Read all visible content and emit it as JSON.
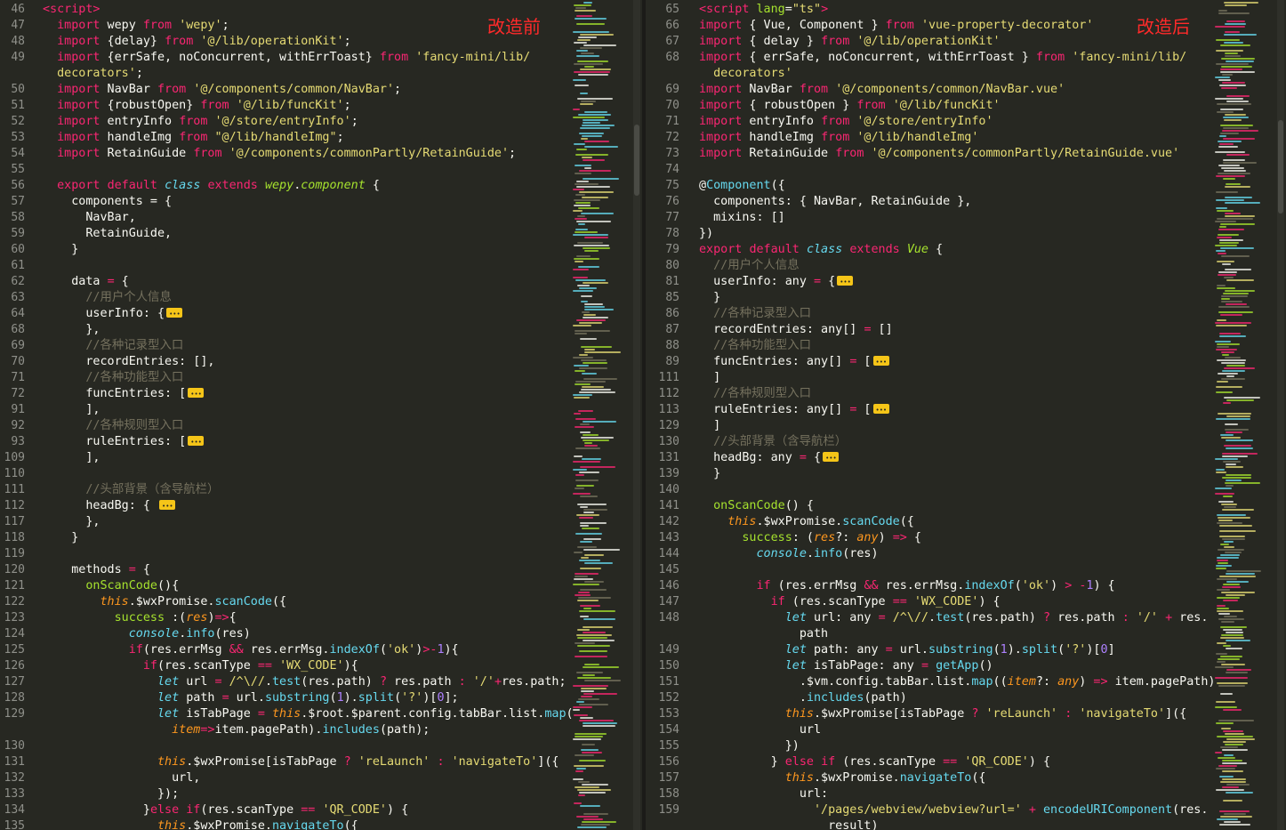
{
  "left_pane": {
    "label": "改造前",
    "lines": [
      {
        "n": "46",
        "html": "<span class='tag'>&lt;script&gt;</span>"
      },
      {
        "n": "47",
        "html": "  <span class='kw'>import</span> wepy <span class='kw'>from</span> <span class='str'>'wepy'</span>;"
      },
      {
        "n": "48",
        "html": "  <span class='kw'>import</span> {delay} <span class='kw'>from</span> <span class='str'>'@/lib/operationKit'</span>;"
      },
      {
        "n": "49",
        "html": "  <span class='kw'>import</span> {errSafe, noConcurrent, withErrToast} <span class='kw'>from</span> <span class='str'>'fancy-mini/lib/</span>"
      },
      {
        "n": "",
        "html": "  <span class='str'>decorators'</span>;"
      },
      {
        "n": "50",
        "html": "  <span class='kw'>import</span> NavBar <span class='kw'>from</span> <span class='str'>'@/components/common/NavBar'</span>;"
      },
      {
        "n": "51",
        "html": "  <span class='kw'>import</span> {robustOpen} <span class='kw'>from</span> <span class='str'>'@/lib/funcKit'</span>;"
      },
      {
        "n": "52",
        "html": "  <span class='kw'>import</span> entryInfo <span class='kw'>from</span> <span class='str'>'@/store/entryInfo'</span>;"
      },
      {
        "n": "53",
        "html": "  <span class='kw'>import</span> handleImg <span class='kw'>from</span> <span class='str'>\"@/lib/handleImg\"</span>;"
      },
      {
        "n": "54",
        "html": "  <span class='kw'>import</span> RetainGuide <span class='kw'>from</span> <span class='str'>'@/components/commonPartly/RetainGuide'</span>;"
      },
      {
        "n": "55",
        "html": ""
      },
      {
        "n": "56",
        "html": "  <span class='kw'>export</span> <span class='kw'>default</span> <span class='it'>class</span> <span class='kw'>extends</span> <span class='cls' style='font-style:italic'>wepy</span>.<span class='cls' style='font-style:italic'>component</span> {"
      },
      {
        "n": "57",
        "html": "    components = {"
      },
      {
        "n": "58",
        "html": "      NavBar,"
      },
      {
        "n": "59",
        "html": "      RetainGuide,"
      },
      {
        "n": "60",
        "html": "    }"
      },
      {
        "n": "61",
        "html": ""
      },
      {
        "n": "62",
        "html": "    data <span class='kw'>=</span> {"
      },
      {
        "n": "63",
        "html": "      <span class='cm'>//用户个人信息</span>"
      },
      {
        "n": "64",
        "html": "      userInfo: {<span class='fold'></span>"
      },
      {
        "n": "68",
        "html": "      },"
      },
      {
        "n": "69",
        "html": "      <span class='cm'>//各种记录型入口</span>"
      },
      {
        "n": "70",
        "html": "      recordEntries: [],"
      },
      {
        "n": "71",
        "html": "      <span class='cm'>//各种功能型入口</span>"
      },
      {
        "n": "72",
        "html": "      funcEntries: [<span class='fold'></span>"
      },
      {
        "n": "91",
        "html": "      ],"
      },
      {
        "n": "92",
        "html": "      <span class='cm'>//各种规则型入口</span>"
      },
      {
        "n": "93",
        "html": "      ruleEntries: [<span class='fold'></span>"
      },
      {
        "n": "109",
        "html": "      ],"
      },
      {
        "n": "110",
        "html": ""
      },
      {
        "n": "111",
        "html": "      <span class='cm'>//头部背景（含导航栏）</span>"
      },
      {
        "n": "112",
        "html": "      headBg: { <span class='fold'></span>"
      },
      {
        "n": "117",
        "html": "      },"
      },
      {
        "n": "118",
        "html": "    }"
      },
      {
        "n": "119",
        "html": ""
      },
      {
        "n": "120",
        "html": "    methods <span class='kw'>=</span> {"
      },
      {
        "n": "121",
        "html": "      <span class='cls'>onScanCode</span>(){"
      },
      {
        "n": "122",
        "html": "        <span class='this'>this</span>.$wxPromise.<span class='fn'>scanCode</span>({"
      },
      {
        "n": "123",
        "html": "          <span class='cls'>success</span> :(<span class='param'>res</span>)<span class='kw'>=&gt;</span>{"
      },
      {
        "n": "124",
        "html": "            <span class='it'>console</span>.<span class='fn'>info</span>(res)"
      },
      {
        "n": "125",
        "html": "            <span class='kw'>if</span>(res.errMsg <span class='kw'>&amp;&amp;</span> res.errMsg.<span class='fn'>indexOf</span>(<span class='str'>'ok'</span>)<span class='kw'>&gt;-</span><span class='num'>1</span>){"
      },
      {
        "n": "126",
        "html": "              <span class='kw'>if</span>(res.scanType <span class='kw'>==</span> <span class='str'>'WX_CODE'</span>){"
      },
      {
        "n": "127",
        "html": "                <span class='it'>let</span> url <span class='kw'>=</span> <span class='str'>/^\\//</span>.<span class='fn'>test</span>(res.path) <span class='kw'>?</span> res.path <span class='kw'>:</span> <span class='str'>'/'</span><span class='kw'>+</span>res.path;"
      },
      {
        "n": "128",
        "html": "                <span class='it'>let</span> path <span class='kw'>=</span> url.<span class='fn'>substring</span>(<span class='num'>1</span>).<span class='fn'>split</span>(<span class='str'>'?'</span>)[<span class='num'>0</span>];"
      },
      {
        "n": "129",
        "html": "                <span class='it'>let</span> isTabPage <span class='kw'>=</span> <span class='this'>this</span>.$root.$parent.config.tabBar.list.<span class='fn'>map</span>("
      },
      {
        "n": "",
        "html": "                  <span class='param'>item</span><span class='kw'>=&gt;</span>item.pagePath).<span class='fn'>includes</span>(path);"
      },
      {
        "n": "130",
        "html": ""
      },
      {
        "n": "131",
        "html": "                <span class='this'>this</span>.$wxPromise[isTabPage <span class='kw'>?</span> <span class='str'>'reLaunch'</span> <span class='kw'>:</span> <span class='str'>'navigateTo'</span>]({"
      },
      {
        "n": "132",
        "html": "                  url,"
      },
      {
        "n": "133",
        "html": "                });"
      },
      {
        "n": "134",
        "html": "              }<span class='kw'>else</span> <span class='kw'>if</span>(res.scanType <span class='kw'>==</span> <span class='str'>'QR_CODE'</span>) {"
      },
      {
        "n": "135",
        "html": "                <span class='this'>this</span>.$wxPromise.<span class='fn'>navigateTo</span>({"
      }
    ]
  },
  "right_pane": {
    "label": "改造后",
    "lines": [
      {
        "n": "65",
        "html": "<span class='tag'>&lt;script</span> <span class='attr'>lang</span>=<span class='str'>\"ts\"</span><span class='tag'>&gt;</span>"
      },
      {
        "n": "66",
        "html": "<span class='kw'>import</span> { Vue, Component } <span class='kw'>from</span> <span class='str'>'vue-property-decorator'</span>"
      },
      {
        "n": "67",
        "html": "<span class='kw'>import</span> { delay } <span class='kw'>from</span> <span class='str'>'@/lib/operationKit'</span>"
      },
      {
        "n": "68",
        "html": "<span class='kw'>import</span> { errSafe, noConcurrent, withErrToast } <span class='kw'>from</span> <span class='str'>'fancy-mini/lib/</span>"
      },
      {
        "n": "",
        "html": "<span class='str'>  decorators'</span>"
      },
      {
        "n": "69",
        "html": "<span class='kw'>import</span> NavBar <span class='kw'>from</span> <span class='str'>'@/components/common/NavBar.vue'</span>"
      },
      {
        "n": "70",
        "html": "<span class='kw'>import</span> { robustOpen } <span class='kw'>from</span> <span class='str'>'@/lib/funcKit'</span>"
      },
      {
        "n": "71",
        "html": "<span class='kw'>import</span> entryInfo <span class='kw'>from</span> <span class='str'>'@/store/entryInfo'</span>"
      },
      {
        "n": "72",
        "html": "<span class='kw'>import</span> handleImg <span class='kw'>from</span> <span class='str'>'@/lib/handleImg'</span>"
      },
      {
        "n": "73",
        "html": "<span class='kw'>import</span> RetainGuide <span class='kw'>from</span> <span class='str'>'@/components/commonPartly/RetainGuide.vue'</span>"
      },
      {
        "n": "74",
        "html": ""
      },
      {
        "n": "75",
        "html": "@<span class='fn'>Component</span>({"
      },
      {
        "n": "76",
        "html": "  components: { NavBar, RetainGuide },"
      },
      {
        "n": "77",
        "html": "  mixins: []"
      },
      {
        "n": "78",
        "html": "})"
      },
      {
        "n": "79",
        "html": "<span class='kw'>export</span> <span class='kw'>default</span> <span class='it'>class</span> <span class='kw'>extends</span> <span class='cls' style='font-style:italic'>Vue</span> {"
      },
      {
        "n": "80",
        "html": "  <span class='cm'>//用户个人信息</span>"
      },
      {
        "n": "81",
        "html": "  userInfo: any <span class='kw'>=</span> {<span class='fold'></span>"
      },
      {
        "n": "85",
        "html": "  }"
      },
      {
        "n": "86",
        "html": "  <span class='cm'>//各种记录型入口</span>"
      },
      {
        "n": "87",
        "html": "  recordEntries: any[] <span class='kw'>=</span> []"
      },
      {
        "n": "88",
        "html": "  <span class='cm'>//各种功能型入口</span>"
      },
      {
        "n": "89",
        "html": "  funcEntries: any[] <span class='kw'>=</span> [<span class='fold'></span>"
      },
      {
        "n": "111",
        "html": "  ]"
      },
      {
        "n": "112",
        "html": "  <span class='cm'>//各种规则型入口</span>"
      },
      {
        "n": "113",
        "html": "  ruleEntries: any[] <span class='kw'>=</span> [<span class='fold'></span>"
      },
      {
        "n": "129",
        "html": "  ]"
      },
      {
        "n": "130",
        "html": "  <span class='cm'>//头部背景（含导航栏）</span>"
      },
      {
        "n": "131",
        "html": "  headBg: any <span class='kw'>=</span> {<span class='fold'></span>"
      },
      {
        "n": "139",
        "html": "  }"
      },
      {
        "n": "140",
        "html": ""
      },
      {
        "n": "141",
        "html": "  <span class='cls'>onScanCode</span>() {"
      },
      {
        "n": "142",
        "html": "    <span class='this'>this</span>.$wxPromise.<span class='fn'>scanCode</span>({"
      },
      {
        "n": "143",
        "html": "      <span class='cls'>success</span>: (<span class='param'>res</span>?: <span class='param'>any</span>) <span class='kw'>=&gt;</span> {"
      },
      {
        "n": "144",
        "html": "        <span class='it'>console</span>.<span class='fn'>info</span>(res)"
      },
      {
        "n": "145",
        "html": ""
      },
      {
        "n": "146",
        "html": "        <span class='kw'>if</span> (res.errMsg <span class='kw'>&amp;&amp;</span> res.errMsg.<span class='fn'>indexOf</span>(<span class='str'>'ok'</span>) <span class='kw'>&gt;</span> <span class='kw'>-</span><span class='num'>1</span>) {"
      },
      {
        "n": "147",
        "html": "          <span class='kw'>if</span> (res.scanType <span class='kw'>==</span> <span class='str'>'WX_CODE'</span>) {"
      },
      {
        "n": "148",
        "html": "            <span class='it'>let</span> url: any <span class='kw'>=</span> <span class='str'>/^\\//</span>.<span class='fn'>test</span>(res.path) <span class='kw'>?</span> res.path <span class='kw'>:</span> <span class='str'>'/'</span> <span class='kw'>+</span> res."
      },
      {
        "n": "",
        "html": "              path"
      },
      {
        "n": "149",
        "html": "            <span class='it'>let</span> path: any <span class='kw'>=</span> url.<span class='fn'>substring</span>(<span class='num'>1</span>).<span class='fn'>split</span>(<span class='str'>'?'</span>)[<span class='num'>0</span>]"
      },
      {
        "n": "150",
        "html": "            <span class='it'>let</span> isTabPage: any <span class='kw'>=</span> <span class='fn'>getApp</span>()"
      },
      {
        "n": "151",
        "html": "              .$vm.config.tabBar.list.<span class='fn'>map</span>((<span class='param'>item</span>?: <span class='param'>any</span>) <span class='kw'>=&gt;</span> item.pagePath)"
      },
      {
        "n": "152",
        "html": "              .<span class='fn'>includes</span>(path)"
      },
      {
        "n": "153",
        "html": "            <span class='this'>this</span>.$wxPromise[isTabPage <span class='kw'>?</span> <span class='str'>'reLaunch'</span> <span class='kw'>:</span> <span class='str'>'navigateTo'</span>]({"
      },
      {
        "n": "154",
        "html": "              url"
      },
      {
        "n": "155",
        "html": "            })"
      },
      {
        "n": "156",
        "html": "          } <span class='kw'>else</span> <span class='kw'>if</span> (res.scanType <span class='kw'>==</span> <span class='str'>'QR_CODE'</span>) {"
      },
      {
        "n": "157",
        "html": "            <span class='this'>this</span>.$wxPromise.<span class='fn'>navigateTo</span>({"
      },
      {
        "n": "158",
        "html": "              url:"
      },
      {
        "n": "159",
        "html": "                <span class='str'>'/pages/webview/webview?url='</span> <span class='kw'>+</span> <span class='fn'>encodeURIComponent</span>(res."
      },
      {
        "n": "",
        "html": "                  result)"
      }
    ]
  },
  "colors": {
    "background": "#272822",
    "annotation": "#ff2a2a",
    "keyword": "#f92672",
    "string": "#e6db74",
    "function": "#66d9ef",
    "comment": "#75715e",
    "fold_marker": "#f5c518"
  },
  "icons": {
    "fold_marker": "ellipsis-fold-icon"
  }
}
